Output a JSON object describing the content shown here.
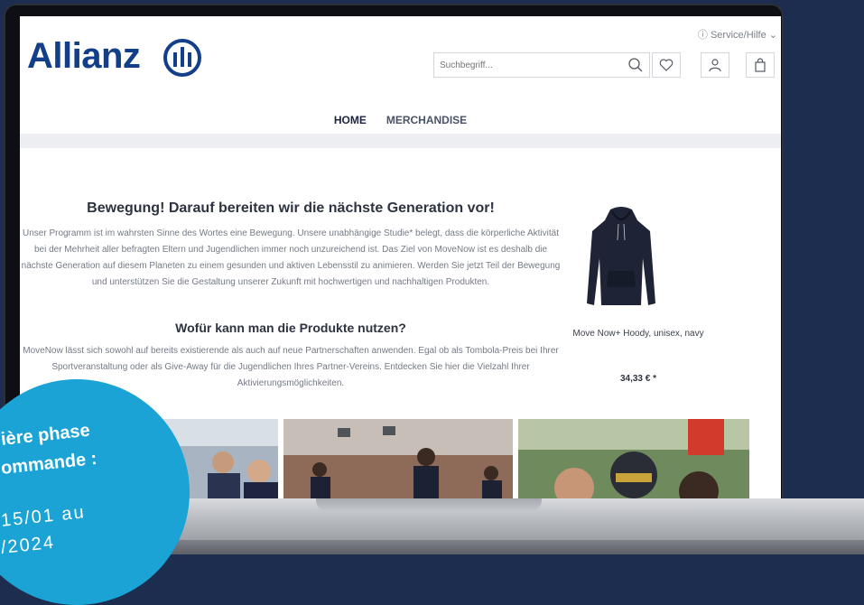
{
  "header": {
    "service_label": "Service/Hilfe",
    "brand": "Allianz",
    "search_placeholder": "Suchbegriff..."
  },
  "nav": {
    "items": [
      {
        "label": "HOME"
      },
      {
        "label": "MERCHANDISE"
      }
    ]
  },
  "content": {
    "heading1": "Bewegung! Darauf bereiten wir die nächste Generation vor!",
    "paragraph1": "Unser Programm ist im wahrsten Sinne des Wortes eine Bewegung. Unsere unabhängige Studie* belegt, dass die körperliche Aktivität bei der Mehrheit aller befragten Eltern und Jugendlichen immer noch unzureichend ist. Das Ziel von MoveNow ist es deshalb die nächste Generation auf diesem Planeten zu einem gesunden und aktiven Lebensstil zu animieren. Werden Sie jetzt Teil der Bewegung und unterstützen Sie die Gestaltung unserer Zukunft mit hochwertigen und nachhaltigen Produkten.",
    "heading2": "Wofür kann man die Produkte nutzen?",
    "paragraph2": "MoveNow lässt sich sowohl auf bereits existierende als auch auf neue Partnerschaften anwenden. Egal ob als Tombola-Preis bei Ihrer Sportveranstaltung oder als Give-Away für die Jugendlichen Ihres Partner-Vereins. Entdecken Sie hier die Vielzahl Ihrer Aktivierungsmöglichkeiten."
  },
  "product": {
    "name": "Move Now+ Hoody, unisex, navy",
    "price": "34,33 € *"
  },
  "promo": {
    "line1": "ière phase",
    "line2": "ommande :",
    "line3": "15/01 au",
    "line4": "/2024"
  },
  "colors": {
    "brand_blue": "#123e8a",
    "promo_blue": "#1aa3d4",
    "background": "#1d2d4f"
  }
}
